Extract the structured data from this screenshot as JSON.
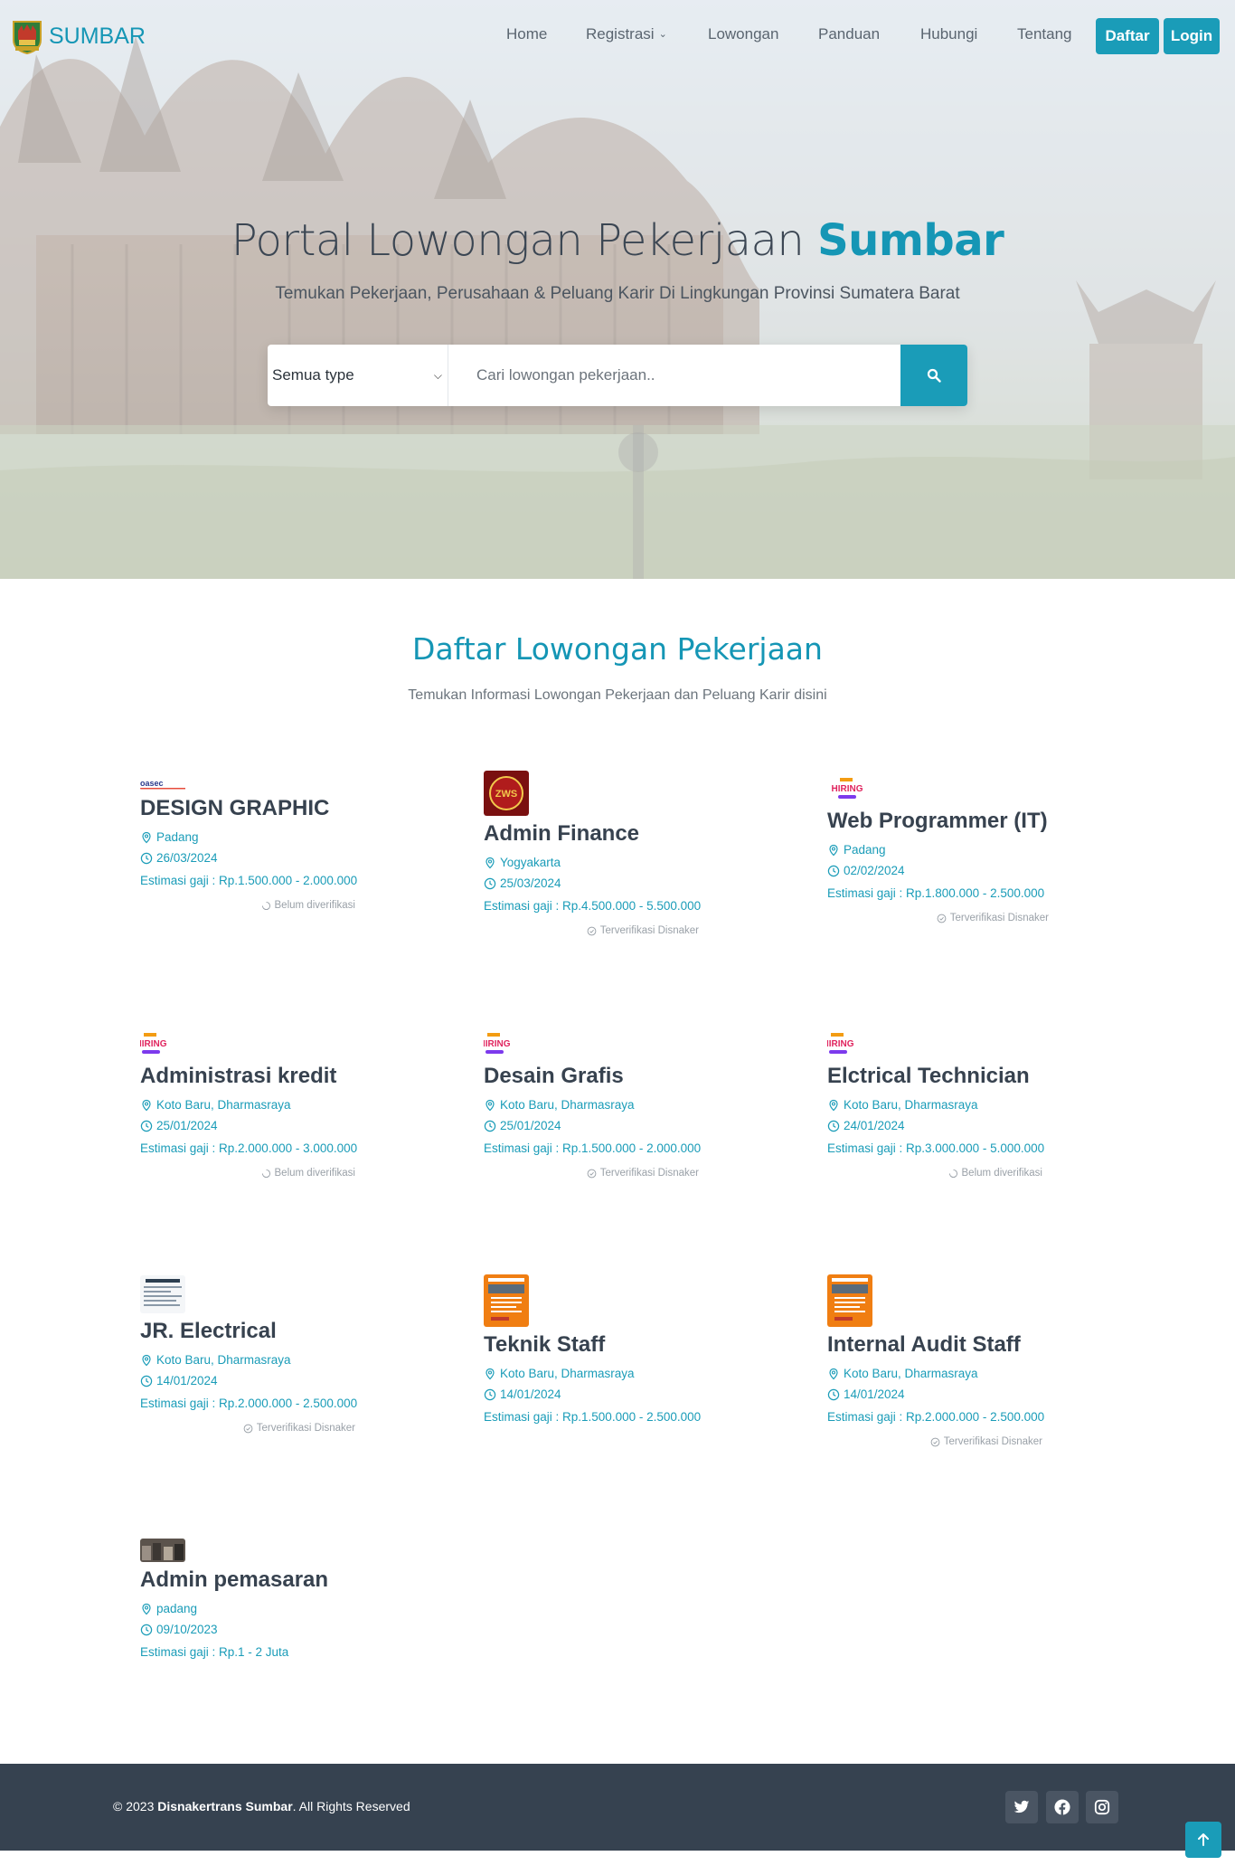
{
  "brand": {
    "name": "SUMBAR",
    "logo": "west-sumatra-emblem"
  },
  "nav": {
    "items": [
      {
        "label": "Home"
      },
      {
        "label": "Registrasi",
        "has_dropdown": true
      },
      {
        "label": "Lowongan"
      },
      {
        "label": "Panduan"
      },
      {
        "label": "Hubungi"
      },
      {
        "label": "Tentang"
      }
    ],
    "register_label": "Daftar",
    "login_label": "Login"
  },
  "hero": {
    "title_prefix": "Portal Lowongan Pekerjaan",
    "title_highlight": "Sumbar",
    "subtitle": "Temukan Pekerjaan, Perusahaan & Peluang Karir Di Lingkungan Provinsi Sumatera Barat",
    "background": "rumah-gadang-photo"
  },
  "search": {
    "type_selected": "Semua type",
    "placeholder": "Cari lowongan pekerjaan..",
    "button_icon": "search-icon"
  },
  "section": {
    "title": "Daftar Lowongan Pekerjaan",
    "subtitle": "Temukan Informasi Lowongan Pekerjaan dan Peluang Karir disini"
  },
  "jobs": [
    {
      "title": "DESIGN GRAPHIC",
      "location": "Padang",
      "date": "26/03/2024",
      "salary": "Estimasi gaji : Rp.1.500.000 - 2.000.000",
      "status": "Belum diverifikasi",
      "verified": false,
      "thumb": "oasec-logo"
    },
    {
      "title": "Admin Finance",
      "location": "Yogyakarta",
      "date": "25/03/2024",
      "salary": "Estimasi gaji : Rp.4.500.000 - 5.500.000",
      "status": "Terverifikasi Disnaker",
      "verified": true,
      "thumb": "company-logo-red"
    },
    {
      "title": "Web Programmer (IT)",
      "location": "Padang",
      "date": "02/02/2024",
      "salary": "Estimasi gaji : Rp.1.800.000 - 2.500.000",
      "status": "Terverifikasi Disnaker",
      "verified": true,
      "thumb": "hiring-badge"
    },
    {
      "title": "Administrasi kredit",
      "location": "Koto Baru, Dharmasraya",
      "date": "25/01/2024",
      "salary": "Estimasi gaji : Rp.2.000.000 - 3.000.000",
      "status": "Belum diverifikasi",
      "verified": false,
      "thumb": "hiring-badge"
    },
    {
      "title": "Desain Grafis",
      "location": "Koto Baru, Dharmasraya",
      "date": "25/01/2024",
      "salary": "Estimasi gaji : Rp.1.500.000 - 2.000.000",
      "status": "Terverifikasi Disnaker",
      "verified": true,
      "thumb": "hiring-badge"
    },
    {
      "title": "Elctrical Technician",
      "location": "Koto Baru, Dharmasraya",
      "date": "24/01/2024",
      "salary": "Estimasi gaji : Rp.3.000.000 - 5.000.000",
      "status": "Belum diverifikasi",
      "verified": false,
      "thumb": "hiring-badge"
    },
    {
      "title": "JR. Electrical",
      "location": "Koto Baru, Dharmasraya",
      "date": "14/01/2024",
      "salary": "Estimasi gaji : Rp.2.000.000 - 2.500.000",
      "status": "Terverifikasi Disnaker",
      "verified": true,
      "thumb": "recruitment-doc"
    },
    {
      "title": "Teknik Staff",
      "location": "Koto Baru, Dharmasraya",
      "date": "14/01/2024",
      "salary": "Estimasi gaji : Rp.1.500.000 - 2.500.000",
      "status": "",
      "verified": null,
      "thumb": "orange-poster"
    },
    {
      "title": "Internal Audit Staff",
      "location": "Koto Baru, Dharmasraya",
      "date": "14/01/2024",
      "salary": "Estimasi gaji : Rp.2.000.000 - 2.500.000",
      "status": "Terverifikasi Disnaker",
      "verified": true,
      "thumb": "orange-poster"
    },
    {
      "title": "Admin pemasaran",
      "location": "padang",
      "date": "09/10/2023",
      "salary": "Estimasi gaji : Rp.1 - 2 Juta",
      "status": "",
      "verified": null,
      "thumb": "photo-thumb"
    }
  ],
  "footer": {
    "copyright_prefix": "© 2023",
    "copyright_org": "Disnakertrans Sumbar",
    "copyright_suffix": ". All Rights Reserved",
    "social": [
      "twitter-icon",
      "facebook-icon",
      "instagram-icon"
    ]
  },
  "colors": {
    "accent": "#1a9cb8",
    "footer_bg": "#364250",
    "title_text": "#37424f",
    "muted": "#6c757d"
  }
}
